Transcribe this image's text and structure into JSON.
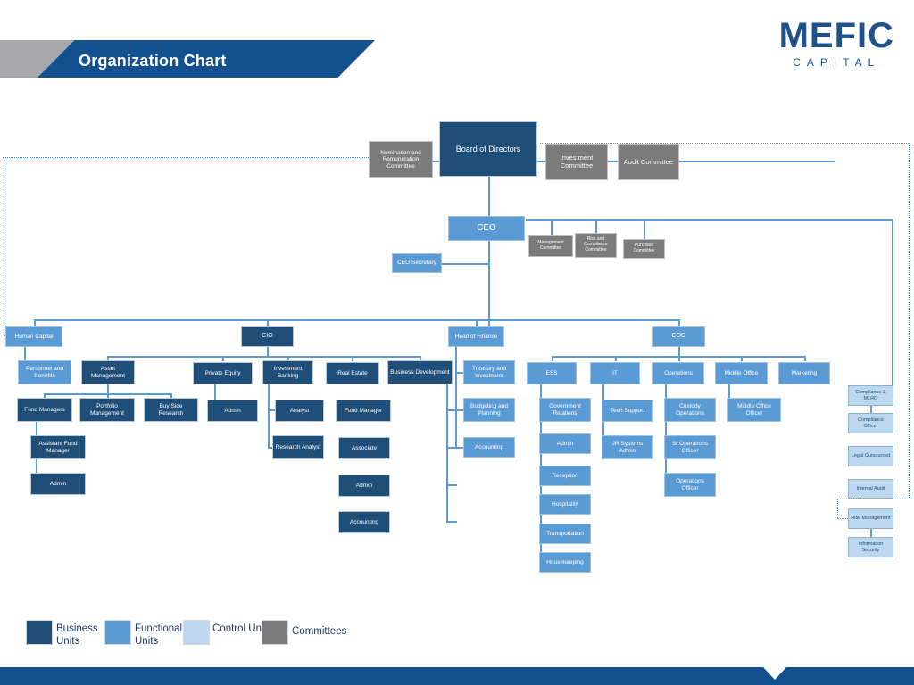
{
  "header": {
    "title": "Organization Chart",
    "logo_main": "MEFIC",
    "logo_sub": "CAPITAL"
  },
  "colors": {
    "business_units": "#1F4E79",
    "functional_units": "#5B9BD5",
    "control_units": "#BDD7EE",
    "committees": "#7B7B7B",
    "header_blue": "#12508F",
    "header_gray": "#A6A8AB",
    "connector": "#5B9BD5"
  },
  "legend": {
    "items": [
      {
        "label": "Business Units",
        "color": "#1F4E79"
      },
      {
        "label": "Functional Units",
        "color": "#5B9BD5"
      },
      {
        "label": "Control Units",
        "color": "#BDD7EE"
      },
      {
        "label": "Committees",
        "color": "#7B7B7B"
      }
    ]
  },
  "chart": {
    "board": "Board of Directors",
    "ceo": "CEO",
    "ceo_secretary": "CEO Secretary",
    "board_committees": [
      "Nomination and Remuneration Committee",
      "Investment Committee",
      "Audit Committee"
    ],
    "ceo_committees": [
      "Management Committee",
      "Risk and Compliance Committee",
      "Purchase Committee"
    ],
    "divisions": {
      "human_capital": "Human Capital",
      "cio": "CIO",
      "head_of_finance": "Head of Finance",
      "coo": "COO"
    },
    "human_capital_children": [
      "Personnel and Benefits"
    ],
    "cio_children": [
      "Asset Management",
      "Private Equity",
      "Investment Banking",
      "Real Estate",
      "Business Development"
    ],
    "asset_management_children": [
      "Fund Managers",
      "Portfolio Management",
      "Buy Side Research"
    ],
    "fund_managers_children": [
      "Assistant Fund Manager",
      "Admin"
    ],
    "private_equity_children": [
      "Admin"
    ],
    "investment_banking_children": [
      "Analyst",
      "Research Analyst"
    ],
    "real_estate_children": [
      "Fund  Manager",
      "Associate",
      "Admin",
      "Accounting"
    ],
    "finance_children": [
      "Treasury and Investment",
      "Budgeting and Planning",
      "Accounting"
    ],
    "coo_children": [
      "ESS",
      "IT",
      "Operations",
      "Middle Office",
      "Marketing"
    ],
    "ess_children": [
      "Government Relations",
      "Admin",
      "Reception",
      "Hospitality",
      "Transportation",
      "Housekeeping"
    ],
    "it_children": [
      "Tech Support",
      "JR  Systems Admin"
    ],
    "operations_children": [
      "Custody Operations",
      "Sr Operations Officer",
      "Operations Officer"
    ],
    "middle_office_children": [
      "Middle Office Officer"
    ],
    "control_units": [
      "Compliance & MLRO",
      "Compliance Officer",
      "Legal Outsourced",
      "Internal Audit",
      "Risk Management",
      "Information Security"
    ]
  }
}
